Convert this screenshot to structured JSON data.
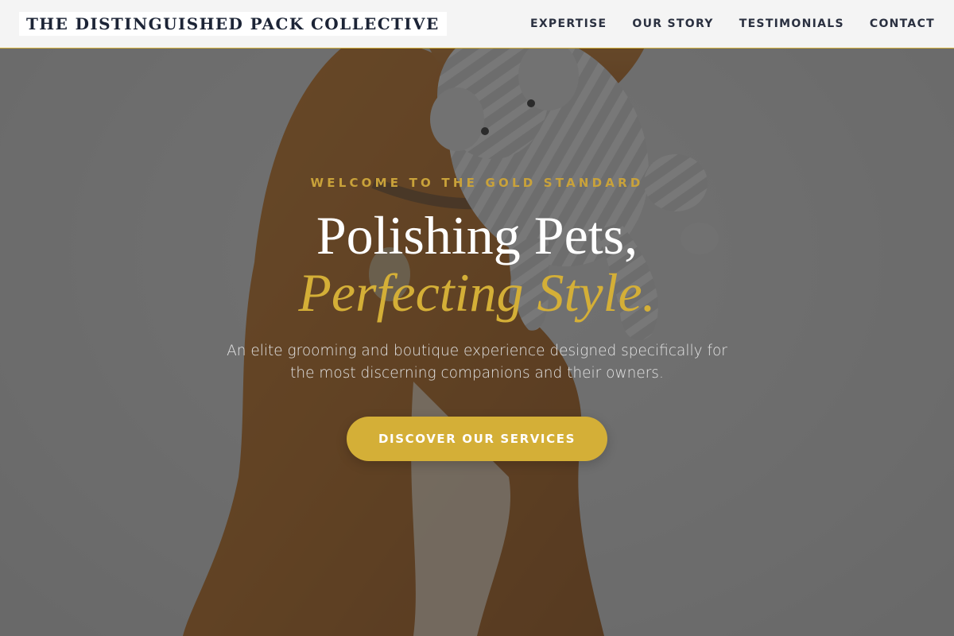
{
  "brand": {
    "name": "THE DISTINGUISHED PACK COLLECTIVE"
  },
  "nav": {
    "items": [
      {
        "label": "EXPERTISE"
      },
      {
        "label": "OUR STORY"
      },
      {
        "label": "TESTIMONIALS"
      },
      {
        "label": "CONTACT"
      }
    ]
  },
  "hero": {
    "eyebrow": "WELCOME TO THE GOLD STANDARD",
    "headline_line1": "Polishing Pets,",
    "headline_line2": "Perfecting Style.",
    "subtext": "An elite grooming and boutique experience designed specifically for the most discerning companions and their owners.",
    "cta_label": "DISCOVER OUR SERVICES",
    "background_image": "dog-with-plush-elephant-toy"
  },
  "colors": {
    "accent_gold": "#d4af37",
    "navy_text": "#1c2436",
    "nav_bg": "#f4f4f4",
    "overlay": "rgba(38,38,38,0.58)"
  }
}
